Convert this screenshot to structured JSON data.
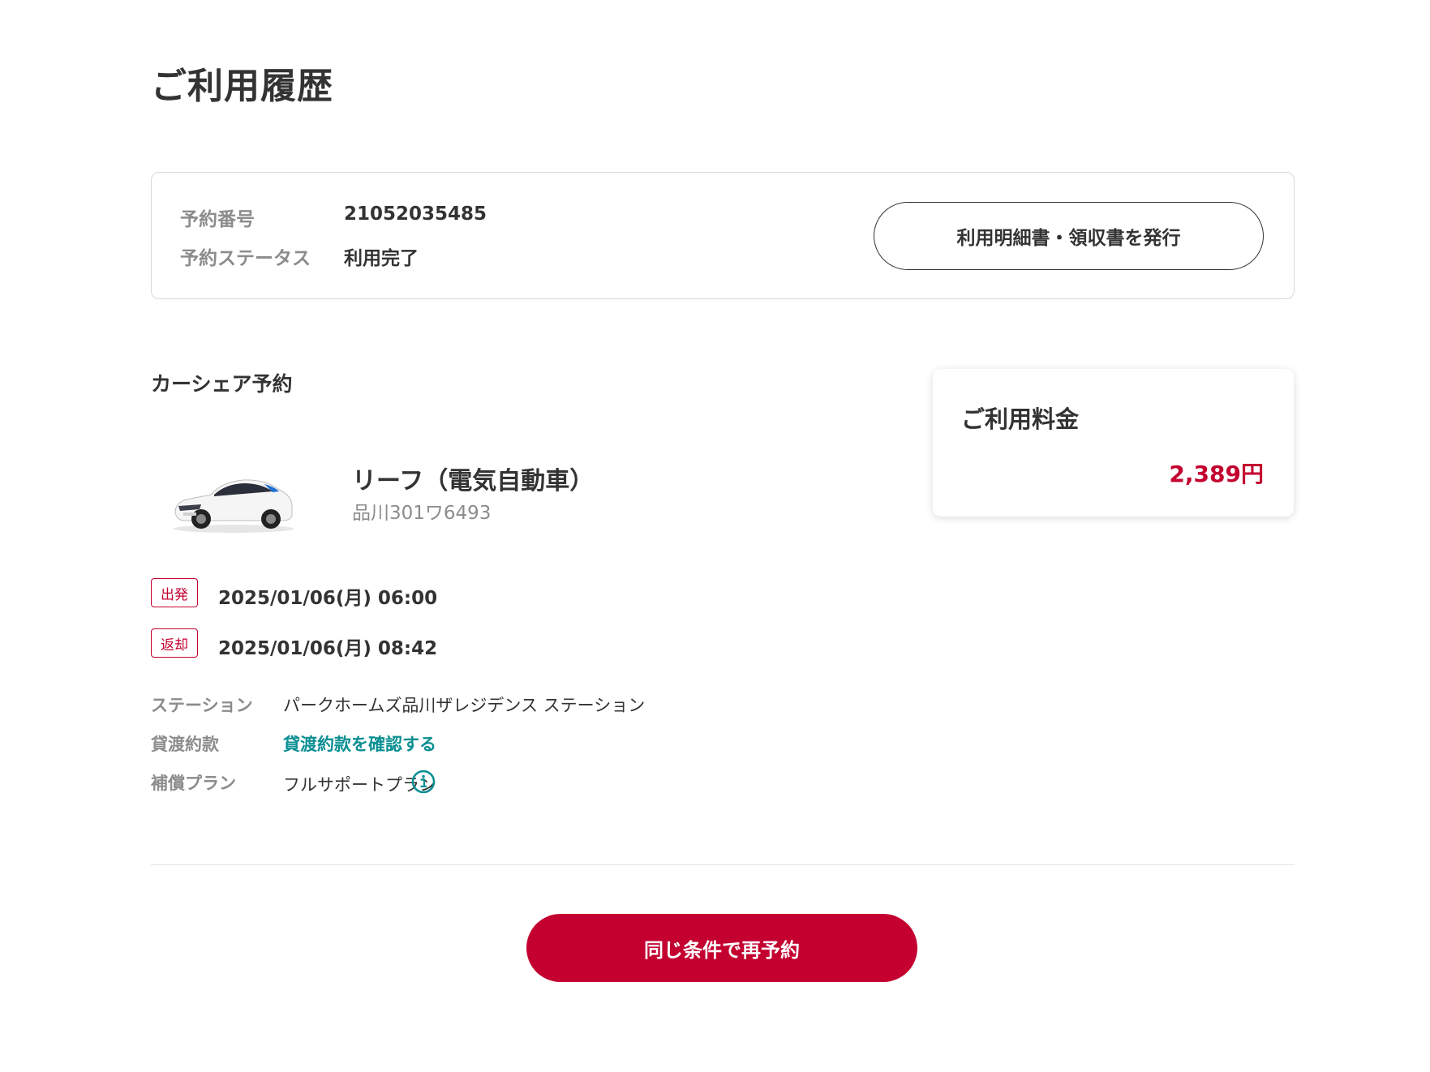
{
  "page": {
    "title": "ご利用履歴"
  },
  "summary": {
    "reservation_number_label": "予約番号",
    "reservation_number": "21052035485",
    "status_label": "予約ステータス",
    "status": "利用完了",
    "receipt_button_label": "利用明細書・領収書を発行"
  },
  "reservation": {
    "section_title": "カーシェア予約",
    "car_name": "リーフ（電気自動車）",
    "plate": "品川301ワ6493",
    "departure_badge": "出発",
    "departure_datetime": "2025/01/06(月) 06:00",
    "return_badge": "返却",
    "return_datetime": "2025/01/06(月) 08:42",
    "station_label": "ステーション",
    "station": "パークホームズ品川ザレジデンス ステーション",
    "terms_label": "貸渡約款",
    "terms_link": "貸渡約款を確認する",
    "plan_label": "補償プラン",
    "plan": "フルサポートプラン"
  },
  "fee": {
    "title": "ご利用料金",
    "amount": "2,389円"
  },
  "actions": {
    "rebook_label": "同じ条件で再予約"
  },
  "colors": {
    "accent": "#c3002f",
    "link": "#0a8f92",
    "text": "#333333",
    "muted": "#8c8c8c"
  },
  "icons": {
    "info": "info-circle-icon",
    "car": "car-image"
  }
}
